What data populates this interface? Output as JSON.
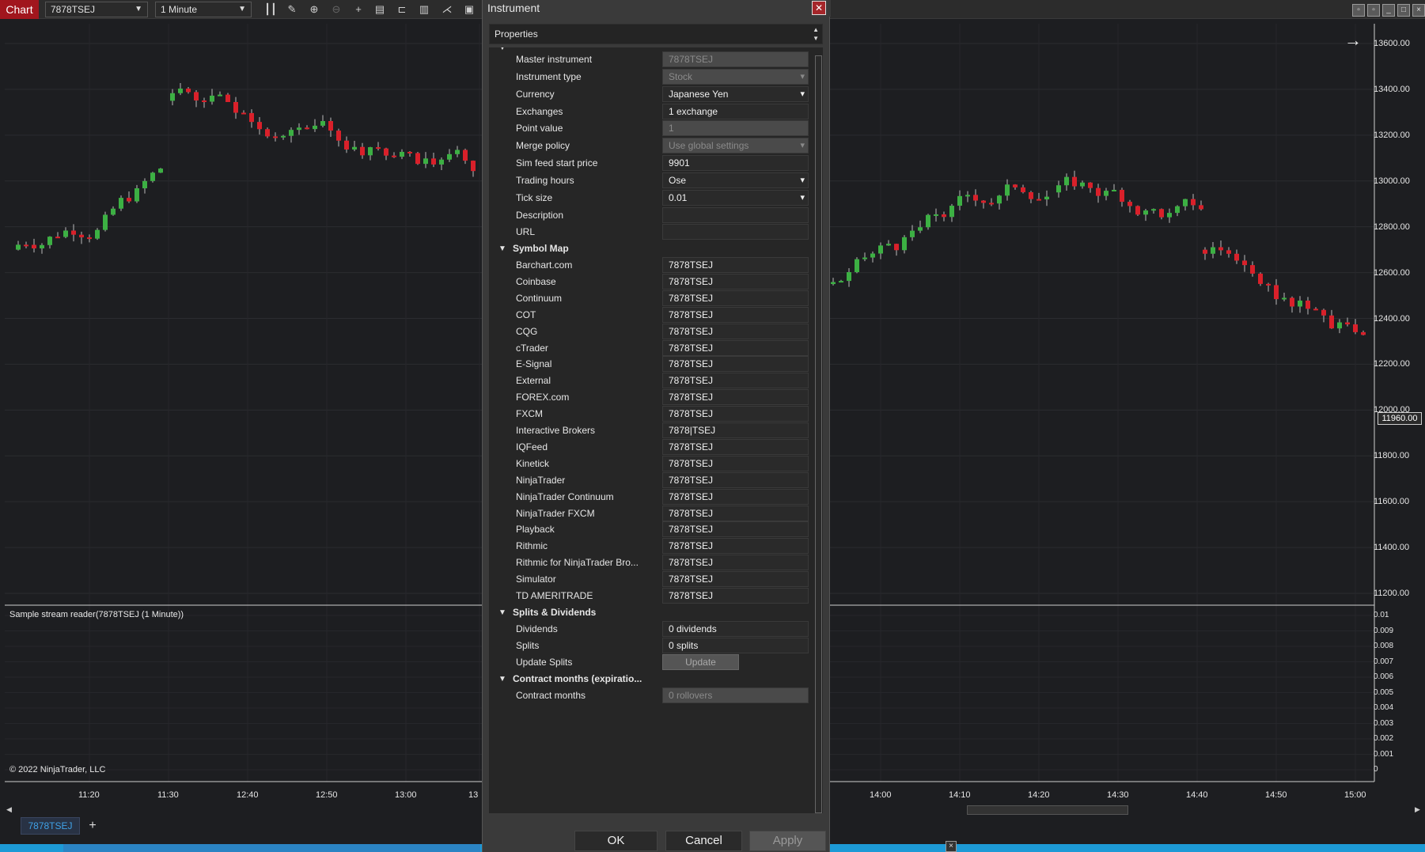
{
  "app": {
    "chart_tab": "Chart",
    "instrument_select": "7878TSEJ",
    "interval_select": "1 Minute",
    "indicator_label": "Sample stream reader(7878TSEJ (1 Minute))",
    "copyright": "© 2022 NinjaTrader, LLC",
    "instrument_tab": "7878TSEJ",
    "add_tab": "+",
    "current_price": "11960.00"
  },
  "price_axis": [
    "13600.00",
    "13400.00",
    "13200.00",
    "13000.00",
    "12800.00",
    "12600.00",
    "12400.00",
    "12200.00",
    "12000.00",
    "11800.00",
    "11600.00",
    "11400.00",
    "11200.00"
  ],
  "indicator_axis": [
    "0.01",
    "0.009",
    "0.008",
    "0.007",
    "0.006",
    "0.005",
    "0.004",
    "0.003",
    "0.002",
    "0.001",
    "0"
  ],
  "time_axis": [
    "11:20",
    "11:30",
    "12:40",
    "12:50",
    "13:00",
    "13",
    "14:00",
    "14:10",
    "14:20",
    "14:30",
    "14:40",
    "14:50",
    "15:00"
  ],
  "dialog": {
    "title": "Instrument",
    "properties_header": "Properties",
    "general_rows": [
      {
        "label": "Master instrument",
        "value": "7878TSEJ",
        "disabled": true,
        "dropdown": false
      },
      {
        "label": "Instrument type",
        "value": "Stock",
        "disabled": true,
        "dropdown": true
      },
      {
        "label": "Currency",
        "value": "Japanese Yen",
        "disabled": false,
        "dropdown": true
      },
      {
        "label": "Exchanges",
        "value": "1 exchange",
        "disabled": false,
        "dropdown": false
      },
      {
        "label": "Point value",
        "value": "1",
        "disabled": true,
        "dropdown": false
      },
      {
        "label": "Merge policy",
        "value": "Use global settings",
        "disabled": true,
        "dropdown": true
      },
      {
        "label": "Sim feed start price",
        "value": "9901",
        "disabled": false,
        "dropdown": false
      },
      {
        "label": "Trading hours",
        "value": "Ose",
        "disabled": false,
        "dropdown": true
      },
      {
        "label": "Tick size",
        "value": "0.01",
        "disabled": false,
        "dropdown": true
      },
      {
        "label": "Description",
        "value": "",
        "disabled": false,
        "dropdown": false
      },
      {
        "label": "URL",
        "value": "",
        "disabled": false,
        "dropdown": false
      }
    ],
    "symbol_map_title": "Symbol Map",
    "symbol_map": [
      {
        "label": "Barchart.com",
        "value": "7878TSEJ"
      },
      {
        "label": "Coinbase",
        "value": "7878TSEJ"
      },
      {
        "label": "Continuum",
        "value": "7878TSEJ"
      },
      {
        "label": "COT",
        "value": "7878TSEJ"
      },
      {
        "label": "CQG",
        "value": "7878TSEJ"
      },
      {
        "label": "cTrader",
        "value": "7878TSEJ"
      },
      {
        "label": "E-Signal",
        "value": "7878TSEJ"
      },
      {
        "label": "External",
        "value": "7878TSEJ"
      },
      {
        "label": "FOREX.com",
        "value": "7878TSEJ"
      },
      {
        "label": "FXCM",
        "value": "7878TSEJ"
      },
      {
        "label": "Interactive Brokers",
        "value": "7878|TSEJ"
      },
      {
        "label": "IQFeed",
        "value": "7878TSEJ"
      },
      {
        "label": "Kinetick",
        "value": "7878TSEJ"
      },
      {
        "label": "NinjaTrader",
        "value": "7878TSEJ"
      },
      {
        "label": "NinjaTrader Continuum",
        "value": "7878TSEJ"
      },
      {
        "label": "NinjaTrader FXCM",
        "value": "7878TSEJ"
      },
      {
        "label": "Playback",
        "value": "7878TSEJ"
      },
      {
        "label": "Rithmic",
        "value": "7878TSEJ"
      },
      {
        "label": "Rithmic for NinjaTrader Bro...",
        "value": "7878TSEJ"
      },
      {
        "label": "Simulator",
        "value": "7878TSEJ"
      },
      {
        "label": "TD AMERITRADE",
        "value": "7878TSEJ"
      }
    ],
    "splits_title": "Splits & Dividends",
    "dividends_label": "Dividends",
    "dividends_value": "0 dividends",
    "splits_label": "Splits",
    "splits_value": "0 splits",
    "update_splits_label": "Update Splits",
    "update_button": "Update",
    "contract_title": "Contract months (expiratio...",
    "contract_label": "Contract months",
    "contract_value": "0 rollovers",
    "ok": "OK",
    "cancel": "Cancel",
    "apply": "Apply"
  },
  "colors": {
    "up": "#3cb043",
    "down": "#d9202a",
    "brand": "#a1161d",
    "accent": "#1d9ad6"
  }
}
